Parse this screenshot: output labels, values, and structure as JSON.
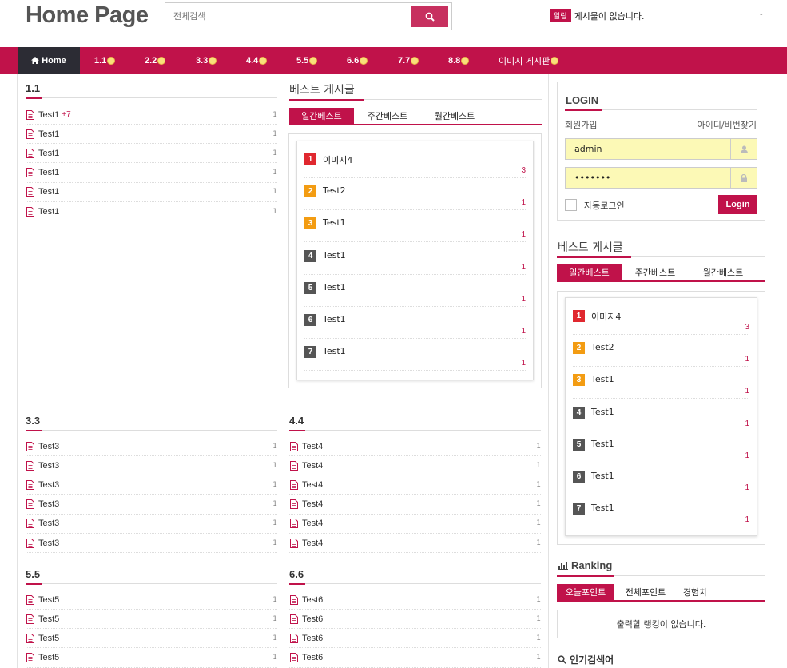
{
  "header": {
    "logo": "Home Page",
    "search_placeholder": "전체검색",
    "notice_badge": "알림",
    "notice_text": "게시물이 없습니다.",
    "right_text": "-"
  },
  "nav": {
    "home": "Home",
    "items": [
      "1.1",
      "2.2",
      "3.3",
      "4.4",
      "5.5",
      "6.6",
      "7.7",
      "8.8",
      "이미지 게시판"
    ]
  },
  "boards": {
    "b11": {
      "title": "1.1",
      "posts": [
        {
          "title": "Test1",
          "extra": "+7",
          "count": "1"
        },
        {
          "title": "Test1",
          "count": "1"
        },
        {
          "title": "Test1",
          "count": "1"
        },
        {
          "title": "Test1",
          "count": "1"
        },
        {
          "title": "Test1",
          "count": "1"
        },
        {
          "title": "Test1",
          "count": "1"
        }
      ]
    },
    "b33": {
      "title": "3.3",
      "posts": [
        {
          "title": "Test3",
          "count": "1"
        },
        {
          "title": "Test3",
          "count": "1"
        },
        {
          "title": "Test3",
          "count": "1"
        },
        {
          "title": "Test3",
          "count": "1"
        },
        {
          "title": "Test3",
          "count": "1"
        },
        {
          "title": "Test3",
          "count": "1"
        }
      ]
    },
    "b44": {
      "title": "4.4",
      "posts": [
        {
          "title": "Test4",
          "count": "1"
        },
        {
          "title": "Test4",
          "count": "1"
        },
        {
          "title": "Test4",
          "count": "1"
        },
        {
          "title": "Test4",
          "count": "1"
        },
        {
          "title": "Test4",
          "count": "1"
        },
        {
          "title": "Test4",
          "count": "1"
        }
      ]
    },
    "b55": {
      "title": "5.5",
      "posts": [
        {
          "title": "Test5",
          "count": "1"
        },
        {
          "title": "Test5",
          "count": "1"
        },
        {
          "title": "Test5",
          "count": "1"
        },
        {
          "title": "Test5",
          "count": "1"
        }
      ]
    },
    "b66": {
      "title": "6.6",
      "posts": [
        {
          "title": "Test6",
          "count": "1"
        },
        {
          "title": "Test6",
          "count": "1"
        },
        {
          "title": "Test6",
          "count": "1"
        },
        {
          "title": "Test6",
          "count": "1"
        }
      ]
    }
  },
  "best": {
    "title": "베스트 게시글",
    "tabs": [
      "일간베스트",
      "주간베스트",
      "월간베스트"
    ],
    "items": [
      {
        "rank": "1",
        "title": "이미지4",
        "count": "3"
      },
      {
        "rank": "2",
        "title": "Test2",
        "count": "1"
      },
      {
        "rank": "3",
        "title": "Test1",
        "count": "1"
      },
      {
        "rank": "4",
        "title": "Test1",
        "count": "1"
      },
      {
        "rank": "5",
        "title": "Test1",
        "count": "1"
      },
      {
        "rank": "6",
        "title": "Test1",
        "count": "1"
      },
      {
        "rank": "7",
        "title": "Test1",
        "count": "1"
      }
    ],
    "rank_colors": [
      "#e0282f",
      "#f39c12",
      "#f39c12",
      "#555555",
      "#555555",
      "#555555",
      "#555555"
    ]
  },
  "login": {
    "title": "LOGIN",
    "join": "회원가입",
    "find": "아이디/비번찾기",
    "username": "admin",
    "password": "•••••••",
    "auto": "자동로그인",
    "button": "Login"
  },
  "ranking": {
    "title": "Ranking",
    "tabs": [
      "오늘포인트",
      "전체포인트",
      "경험치"
    ],
    "empty": "출력할 랭킹이 없습니다."
  },
  "popular": {
    "title": "인기검색어"
  },
  "colors": {
    "accent": "#c0124a",
    "nav_home": "#2c2c34",
    "input_bg": "#fcf9b6"
  }
}
